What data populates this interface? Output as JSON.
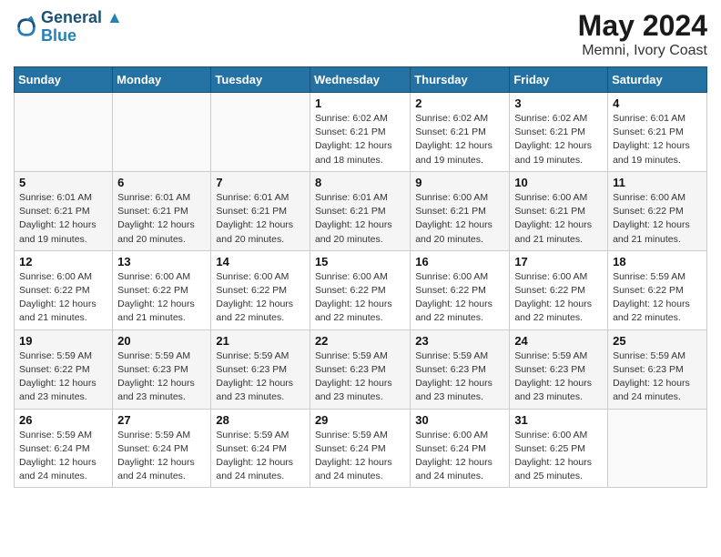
{
  "header": {
    "logo_line1": "General",
    "logo_line2": "Blue",
    "month": "May 2024",
    "location": "Memni, Ivory Coast"
  },
  "weekdays": [
    "Sunday",
    "Monday",
    "Tuesday",
    "Wednesday",
    "Thursday",
    "Friday",
    "Saturday"
  ],
  "weeks": [
    [
      {
        "day": "",
        "info": ""
      },
      {
        "day": "",
        "info": ""
      },
      {
        "day": "",
        "info": ""
      },
      {
        "day": "1",
        "info": "Sunrise: 6:02 AM\nSunset: 6:21 PM\nDaylight: 12 hours\nand 18 minutes."
      },
      {
        "day": "2",
        "info": "Sunrise: 6:02 AM\nSunset: 6:21 PM\nDaylight: 12 hours\nand 19 minutes."
      },
      {
        "day": "3",
        "info": "Sunrise: 6:02 AM\nSunset: 6:21 PM\nDaylight: 12 hours\nand 19 minutes."
      },
      {
        "day": "4",
        "info": "Sunrise: 6:01 AM\nSunset: 6:21 PM\nDaylight: 12 hours\nand 19 minutes."
      }
    ],
    [
      {
        "day": "5",
        "info": "Sunrise: 6:01 AM\nSunset: 6:21 PM\nDaylight: 12 hours\nand 19 minutes."
      },
      {
        "day": "6",
        "info": "Sunrise: 6:01 AM\nSunset: 6:21 PM\nDaylight: 12 hours\nand 20 minutes."
      },
      {
        "day": "7",
        "info": "Sunrise: 6:01 AM\nSunset: 6:21 PM\nDaylight: 12 hours\nand 20 minutes."
      },
      {
        "day": "8",
        "info": "Sunrise: 6:01 AM\nSunset: 6:21 PM\nDaylight: 12 hours\nand 20 minutes."
      },
      {
        "day": "9",
        "info": "Sunrise: 6:00 AM\nSunset: 6:21 PM\nDaylight: 12 hours\nand 20 minutes."
      },
      {
        "day": "10",
        "info": "Sunrise: 6:00 AM\nSunset: 6:21 PM\nDaylight: 12 hours\nand 21 minutes."
      },
      {
        "day": "11",
        "info": "Sunrise: 6:00 AM\nSunset: 6:22 PM\nDaylight: 12 hours\nand 21 minutes."
      }
    ],
    [
      {
        "day": "12",
        "info": "Sunrise: 6:00 AM\nSunset: 6:22 PM\nDaylight: 12 hours\nand 21 minutes."
      },
      {
        "day": "13",
        "info": "Sunrise: 6:00 AM\nSunset: 6:22 PM\nDaylight: 12 hours\nand 21 minutes."
      },
      {
        "day": "14",
        "info": "Sunrise: 6:00 AM\nSunset: 6:22 PM\nDaylight: 12 hours\nand 22 minutes."
      },
      {
        "day": "15",
        "info": "Sunrise: 6:00 AM\nSunset: 6:22 PM\nDaylight: 12 hours\nand 22 minutes."
      },
      {
        "day": "16",
        "info": "Sunrise: 6:00 AM\nSunset: 6:22 PM\nDaylight: 12 hours\nand 22 minutes."
      },
      {
        "day": "17",
        "info": "Sunrise: 6:00 AM\nSunset: 6:22 PM\nDaylight: 12 hours\nand 22 minutes."
      },
      {
        "day": "18",
        "info": "Sunrise: 5:59 AM\nSunset: 6:22 PM\nDaylight: 12 hours\nand 22 minutes."
      }
    ],
    [
      {
        "day": "19",
        "info": "Sunrise: 5:59 AM\nSunset: 6:22 PM\nDaylight: 12 hours\nand 23 minutes."
      },
      {
        "day": "20",
        "info": "Sunrise: 5:59 AM\nSunset: 6:23 PM\nDaylight: 12 hours\nand 23 minutes."
      },
      {
        "day": "21",
        "info": "Sunrise: 5:59 AM\nSunset: 6:23 PM\nDaylight: 12 hours\nand 23 minutes."
      },
      {
        "day": "22",
        "info": "Sunrise: 5:59 AM\nSunset: 6:23 PM\nDaylight: 12 hours\nand 23 minutes."
      },
      {
        "day": "23",
        "info": "Sunrise: 5:59 AM\nSunset: 6:23 PM\nDaylight: 12 hours\nand 23 minutes."
      },
      {
        "day": "24",
        "info": "Sunrise: 5:59 AM\nSunset: 6:23 PM\nDaylight: 12 hours\nand 23 minutes."
      },
      {
        "day": "25",
        "info": "Sunrise: 5:59 AM\nSunset: 6:23 PM\nDaylight: 12 hours\nand 24 minutes."
      }
    ],
    [
      {
        "day": "26",
        "info": "Sunrise: 5:59 AM\nSunset: 6:24 PM\nDaylight: 12 hours\nand 24 minutes."
      },
      {
        "day": "27",
        "info": "Sunrise: 5:59 AM\nSunset: 6:24 PM\nDaylight: 12 hours\nand 24 minutes."
      },
      {
        "day": "28",
        "info": "Sunrise: 5:59 AM\nSunset: 6:24 PM\nDaylight: 12 hours\nand 24 minutes."
      },
      {
        "day": "29",
        "info": "Sunrise: 5:59 AM\nSunset: 6:24 PM\nDaylight: 12 hours\nand 24 minutes."
      },
      {
        "day": "30",
        "info": "Sunrise: 6:00 AM\nSunset: 6:24 PM\nDaylight: 12 hours\nand 24 minutes."
      },
      {
        "day": "31",
        "info": "Sunrise: 6:00 AM\nSunset: 6:25 PM\nDaylight: 12 hours\nand 25 minutes."
      },
      {
        "day": "",
        "info": ""
      }
    ]
  ]
}
